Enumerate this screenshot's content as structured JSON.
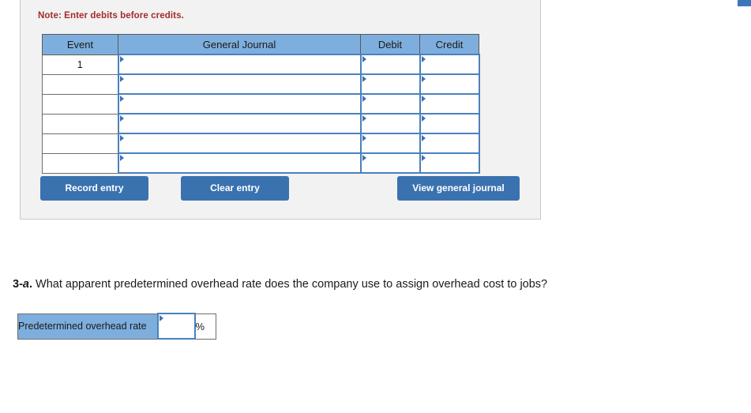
{
  "journal_panel": {
    "note": "Note: Enter debits before credits.",
    "table": {
      "headers": [
        "Event",
        "General Journal",
        "Debit",
        "Credit"
      ],
      "rows": [
        {
          "event": "1",
          "general_journal": "",
          "debit": "",
          "credit": ""
        },
        {
          "event": "",
          "general_journal": "",
          "debit": "",
          "credit": ""
        },
        {
          "event": "",
          "general_journal": "",
          "debit": "",
          "credit": ""
        },
        {
          "event": "",
          "general_journal": "",
          "debit": "",
          "credit": ""
        },
        {
          "event": "",
          "general_journal": "",
          "debit": "",
          "credit": ""
        },
        {
          "event": "",
          "general_journal": "",
          "debit": "",
          "credit": ""
        }
      ]
    },
    "buttons": {
      "record": "Record entry",
      "clear": "Clear entry",
      "view": "View general journal"
    }
  },
  "question": {
    "number": "3-a.",
    "number_prefix": "3-",
    "number_letter": "a",
    "number_suffix": ".",
    "text": "What apparent predetermined overhead rate does the company use to assign overhead cost to jobs?"
  },
  "answer": {
    "label": "Predetermined overhead rate",
    "value": "",
    "unit": "%"
  },
  "colors": {
    "header_blue": "#7eaede",
    "button_blue": "#3a72b0",
    "input_border_blue": "#4a81bd",
    "note_red": "#a52a2a",
    "panel_bg": "#f2f2f2"
  }
}
